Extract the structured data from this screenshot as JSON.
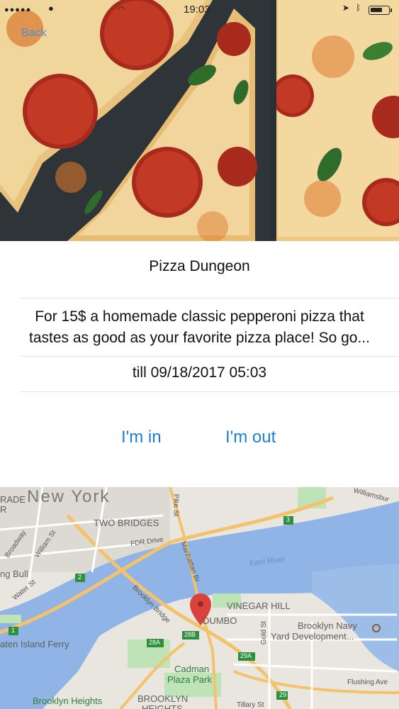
{
  "status_bar": {
    "signal": "●●●●●",
    "time": "19:03"
  },
  "nav": {
    "back_label": "Back"
  },
  "event": {
    "title": "Pizza Dungeon",
    "description_line1": "For 15$ a homemade classic pepperoni pizza that",
    "description_line2": "tastes as good as your favorite pizza place! So go...",
    "date": "till 09/18/2017 05:03"
  },
  "actions": {
    "in_label": "I'm in",
    "out_label": "I'm out"
  },
  "map": {
    "labels": {
      "new_york": "New York",
      "rade": "RADE",
      "r": "R",
      "two_bridges": "TWO BRIDGES",
      "fdr_drive": "FDR Drive",
      "east_river": "East River",
      "ng_bull": "ng Bull",
      "water_st": "Water St",
      "broadway": "Broadway",
      "william_st": "William St",
      "brooklyn_bridge": "Brooklyn Bridge",
      "manhattan_br": "Manhattan Br",
      "pike_st": "Pike St",
      "vinegar_hill": "VINEGAR HILL",
      "dumbo": "DUMBO",
      "brooklyn_navy_1": "Brooklyn Navy",
      "brooklyn_navy_2": "Yard Development...",
      "staten_ferry": "aten Island Ferry",
      "cadman_1": "Cadman",
      "cadman_2": "Plaza Park",
      "brooklyn_heights": "Brooklyn Heights",
      "brooklyn_heights_caps": "BROOKLYN",
      "heights_caps": "HEIGHTS",
      "flushing": "Flushing Ave",
      "williamsburg": "Williamsbur",
      "gold_st": "Gold St",
      "tillary": "Tillary St",
      "shield_3": "3",
      "shield_2": "2",
      "shield_1": "1",
      "shield_28a": "28A",
      "shield_28b": "28B",
      "shield_29a": "29A",
      "shield_29": "29"
    }
  }
}
